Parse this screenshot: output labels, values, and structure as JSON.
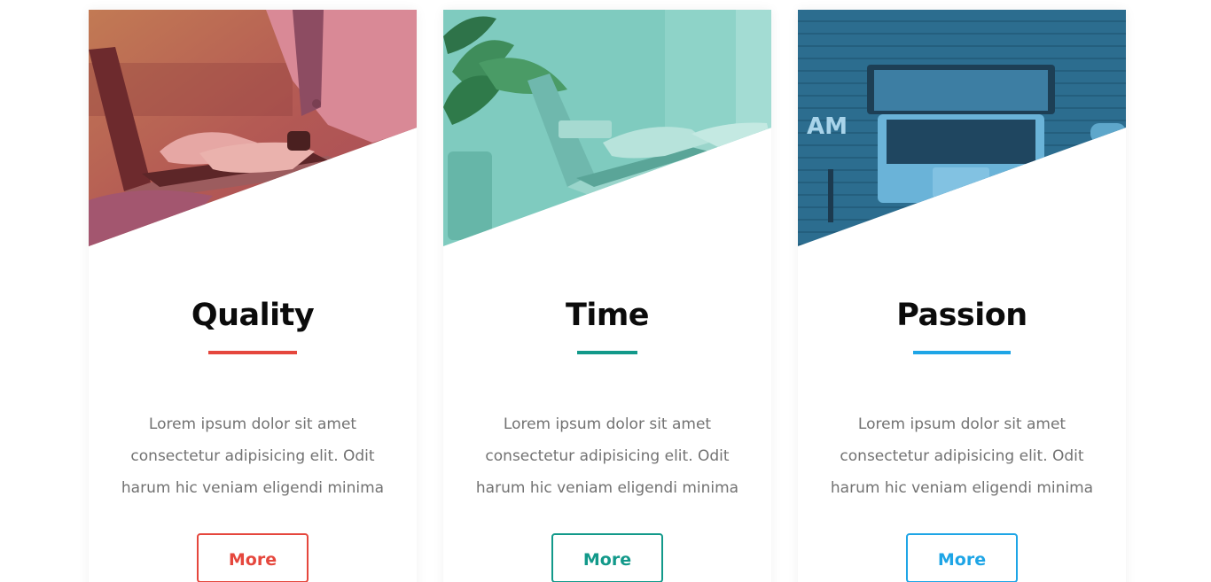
{
  "cards": [
    {
      "title": "Quality",
      "text_lines": [
        "Lorem ipsum dolor sit amet",
        "consectetur adipisicing elit. Odit",
        "harum hic veniam eligendi minima"
      ],
      "button_label": "More",
      "accent_color": "#e5473d",
      "image": "person-typing-on-laptop",
      "tint": "#c64a4d"
    },
    {
      "title": "Time",
      "text_lines": [
        "Lorem ipsum dolor sit amet",
        "consectetur adipisicing elit. Odit",
        "harum hic veniam eligendi minima"
      ],
      "button_label": "More",
      "accent_color": "#12998a",
      "image": "hands-on-laptop-with-plant",
      "tint": "#5fbfb2"
    },
    {
      "title": "Passion",
      "text_lines": [
        "Lorem ipsum dolor sit amet",
        "consectetur adipisicing elit. Odit",
        "harum hic veniam eligendi minima"
      ],
      "button_label": "More",
      "accent_color": "#1ea5e6",
      "image": "laptop-on-wooden-desk",
      "tint": "#2f7ea4"
    }
  ]
}
